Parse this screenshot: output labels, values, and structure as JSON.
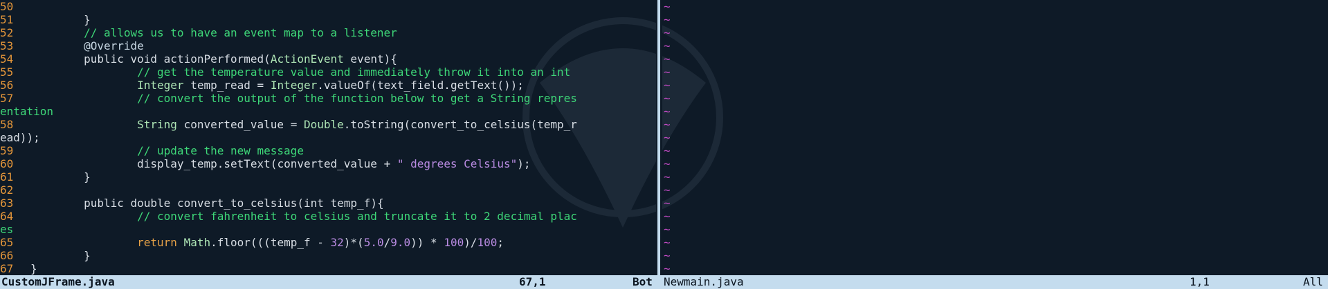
{
  "left_pane": {
    "lines": [
      {
        "n": "50",
        "text": ""
      },
      {
        "n": "51",
        "text": "        }"
      },
      {
        "n": "52",
        "text": "        // allows us to have an event map to a listener"
      },
      {
        "n": "53",
        "text": "        @Override"
      },
      {
        "n": "54",
        "text": "        public void actionPerformed(ActionEvent event){"
      },
      {
        "n": "55",
        "text": "                // get the temperature value and immediately throw it into an int"
      },
      {
        "n": "56",
        "text": "                Integer temp_read = Integer.valueOf(text_field.getText());"
      },
      {
        "n": "57",
        "text": "                // convert the output of the function below to get a String repres"
      },
      {
        "n": "",
        "text": "entation"
      },
      {
        "n": "58",
        "text": "                String converted_value = Double.toString(convert_to_celsius(temp_r"
      },
      {
        "n": "",
        "text": "ead));"
      },
      {
        "n": "59",
        "text": "                // update the new message"
      },
      {
        "n": "60",
        "text": "                display_temp.setText(converted_value + \" degrees Celsius\");"
      },
      {
        "n": "61",
        "text": "        }"
      },
      {
        "n": "62",
        "text": ""
      },
      {
        "n": "63",
        "text": "        public double convert_to_celsius(int temp_f){"
      },
      {
        "n": "64",
        "text": "                // convert fahrenheit to celsius and truncate it to 2 decimal plac"
      },
      {
        "n": "",
        "text": "es"
      },
      {
        "n": "65",
        "text": "                return Math.floor(((temp_f - 32)*(5.0/9.0)) * 100)/100;"
      },
      {
        "n": "66",
        "text": "        }"
      },
      {
        "n": "67",
        "text": "}"
      }
    ]
  },
  "right_pane": {
    "tilde": "~"
  },
  "status_left": {
    "filename": "CustomJFrame.java",
    "position": "67,1",
    "scroll": "Bot"
  },
  "status_right": {
    "filename": "Newmain.java",
    "position": "1,1",
    "scroll": "All"
  },
  "colors": {
    "background": "#0e1a27",
    "line_number": "#e4963a",
    "comment": "#3ed778",
    "number": "#b98be2",
    "statusbar": "#c4dcee",
    "tilde": "#c24bc4"
  }
}
